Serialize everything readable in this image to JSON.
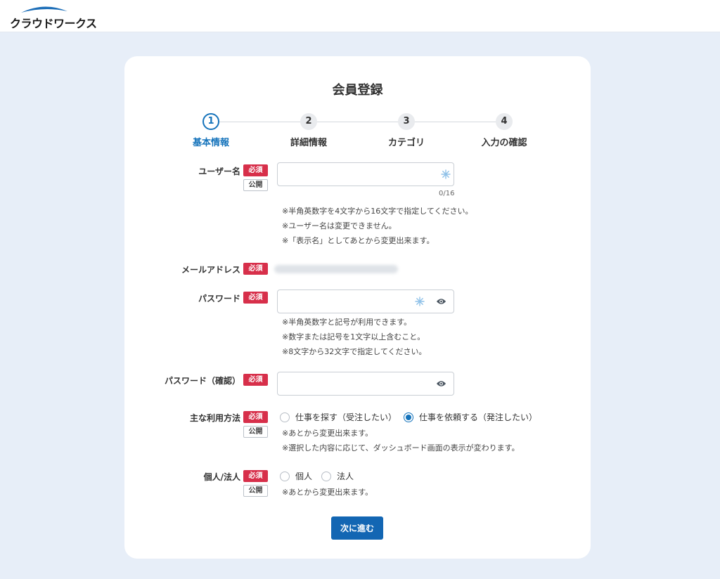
{
  "header": {
    "logo_text": "クラウドワークス"
  },
  "page": {
    "title": "会員登録"
  },
  "steps": [
    {
      "number": "1",
      "label": "基本情報",
      "active": true
    },
    {
      "number": "2",
      "label": "詳細情報",
      "active": false
    },
    {
      "number": "3",
      "label": "カテゴリ",
      "active": false
    },
    {
      "number": "4",
      "label": "入力の確認",
      "active": false
    }
  ],
  "badges": {
    "required": "必須",
    "public": "公開"
  },
  "form": {
    "username": {
      "label": "ユーザー名",
      "value": "",
      "counter": "0/16",
      "notes": [
        "※半角英数字を4文字から16文字で指定してください。",
        "※ユーザー名は変更できません。",
        "※「表示名」としてあとから変更出来ます。"
      ]
    },
    "email": {
      "label": "メールアドレス"
    },
    "password": {
      "label": "パスワード",
      "value": "",
      "notes": [
        "※半角英数字と記号が利用できます。",
        "※数字または記号を1文字以上含むこと。",
        "※8文字から32文字で指定してください。"
      ]
    },
    "password_confirm": {
      "label": "パスワード（確認）",
      "value": ""
    },
    "usage": {
      "label": "主な利用方法",
      "options": [
        {
          "label": "仕事を探す（受注したい）",
          "selected": false
        },
        {
          "label": "仕事を依頼する（発注したい）",
          "selected": true
        }
      ],
      "notes": [
        "※あとから変更出来ます。",
        "※選択した内容に応じて、ダッシュボード画面の表示が変わります。"
      ]
    },
    "entity": {
      "label": "個人/法人",
      "options": [
        {
          "label": "個人",
          "selected": false
        },
        {
          "label": "法人",
          "selected": false
        }
      ],
      "notes": [
        "※あとから変更出来ます。"
      ]
    }
  },
  "actions": {
    "next_label": "次に進む"
  },
  "colors": {
    "accent": "#1573bb",
    "required_badge": "#d72f4a",
    "background": "#e7eef8",
    "button": "#1366b3"
  },
  "icons": {
    "logo": "crowdworks-logo",
    "field_icon": "sparkle-icon",
    "visibility": "eye-icon"
  }
}
